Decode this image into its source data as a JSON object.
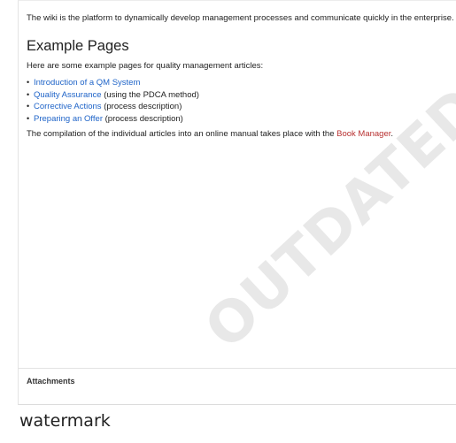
{
  "article": {
    "intro": "The wiki is the platform to dynamically develop management processes and communicate quickly in the enterprise.",
    "section_heading": "Example Pages",
    "section_intro": "Here are some example pages for quality management articles:",
    "items": [
      {
        "link": "Introduction of a QM System",
        "suffix": ""
      },
      {
        "link": "Quality Assurance",
        "suffix": " (using the PDCA method)"
      },
      {
        "link": "Corrective Actions",
        "suffix": " (process description)"
      },
      {
        "link": "Preparing an Offer",
        "suffix": " (process description)"
      }
    ],
    "compilation_prefix": "The compilation of the individual articles into an online manual takes place with the ",
    "compilation_link": "Book Manager",
    "compilation_suffix": "."
  },
  "watermark": "OUTDATED",
  "attachments_label": "Attachments",
  "caption": "watermark",
  "colors": {
    "link": "#1f64c8",
    "redlink": "#b83232",
    "watermark": "#e8e8e8"
  },
  "icons": {
    "bullet": "bullet-icon"
  }
}
